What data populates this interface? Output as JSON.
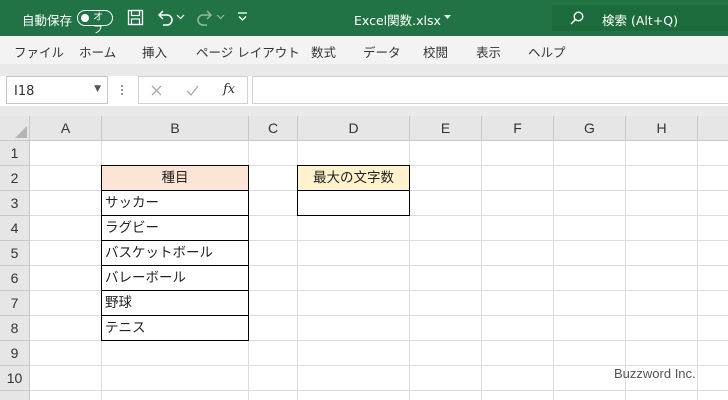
{
  "titlebar": {
    "autosave_label": "自動保存",
    "autosave_state": "オフ",
    "filename": "Excel関数.xlsx",
    "search_placeholder": "検索 (Alt+Q)",
    "bg_color": "#217346"
  },
  "ribbon_tabs": [
    "ファイル",
    "ホーム",
    "挿入",
    "ページ レイアウト",
    "数式",
    "データ",
    "校閲",
    "表示",
    "ヘルプ"
  ],
  "formula_bar": {
    "name_box": "I18",
    "fx_label": "fx",
    "formula": ""
  },
  "grid": {
    "columns": [
      "A",
      "B",
      "C",
      "D",
      "E",
      "F",
      "G",
      "H"
    ],
    "rows": [
      "1",
      "2",
      "3",
      "4",
      "5",
      "6",
      "7",
      "8",
      "9",
      "10"
    ],
    "b_header": "種目",
    "b_items": [
      "サッカー",
      "ラグビー",
      "バスケットボール",
      "バレーボール",
      "野球",
      "テニス"
    ],
    "d_header": "最大の文字数",
    "d3_value": ""
  },
  "colors": {
    "header_orange": "#fce4d6",
    "header_yellow": "#fff2cc"
  },
  "watermark": "Buzzword Inc."
}
